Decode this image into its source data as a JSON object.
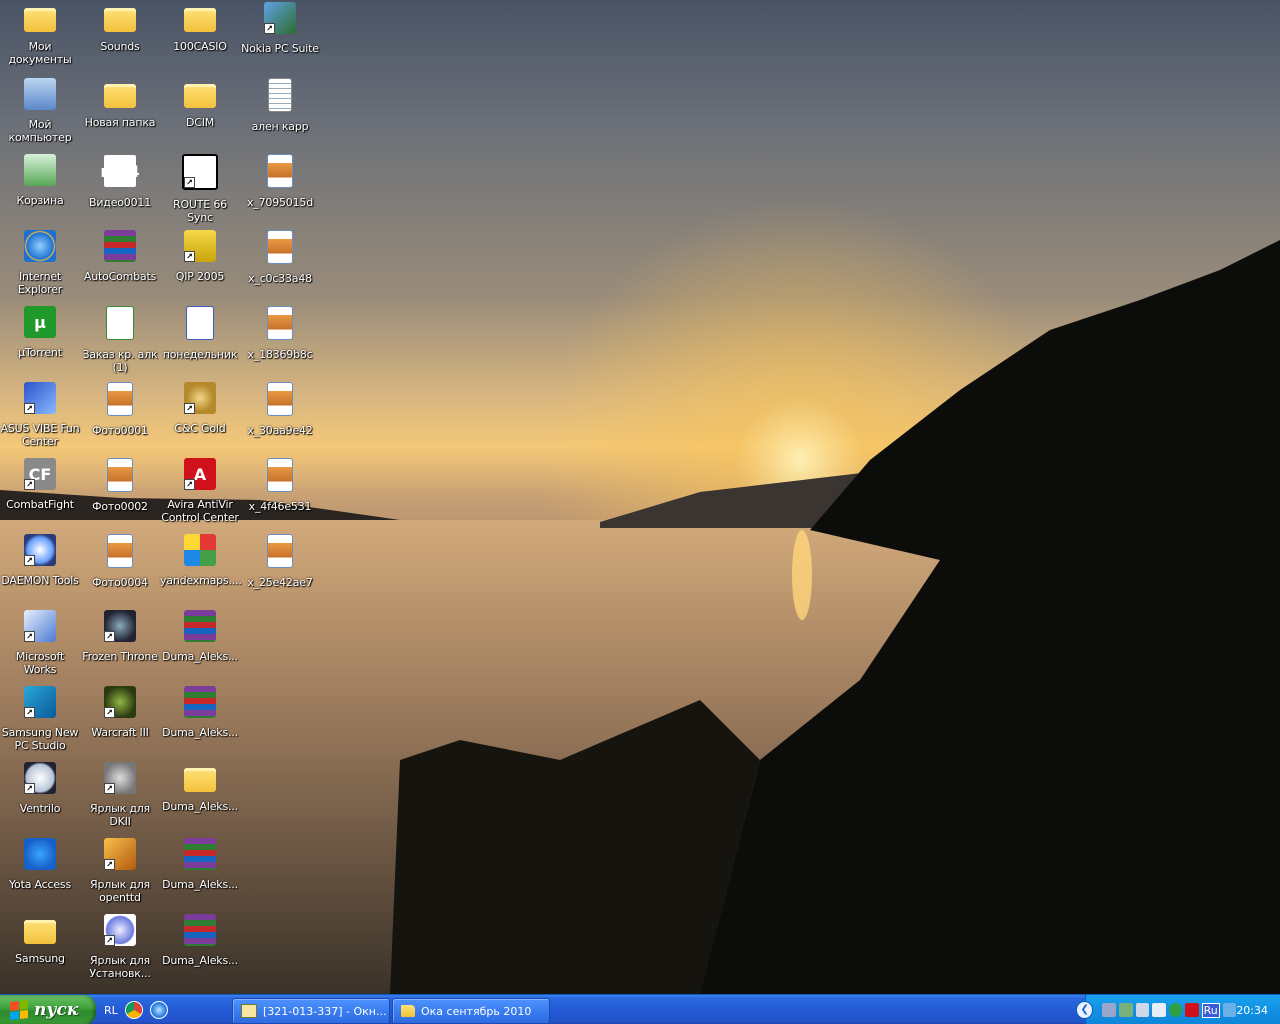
{
  "desktop": {
    "icons": [
      {
        "label": "Мои документы",
        "icon": "my-documents-icon",
        "col": 0,
        "row": 0,
        "art": "folder",
        "shortcut": false
      },
      {
        "label": "Мой компьютер",
        "icon": "my-computer-icon",
        "col": 0,
        "row": 1,
        "art": "computer",
        "shortcut": false
      },
      {
        "label": "Корзина",
        "icon": "recycle-bin-icon",
        "col": 0,
        "row": 2,
        "art": "recycle",
        "shortcut": false
      },
      {
        "label": "Internet Explorer",
        "icon": "internet-explorer-icon",
        "col": 0,
        "row": 3,
        "art": "ie",
        "shortcut": false
      },
      {
        "label": "µTorrent",
        "icon": "utorrent-icon",
        "col": 0,
        "row": 4,
        "art": "utor",
        "shortcut": false
      },
      {
        "label": "ASUS VIBE Fun Center",
        "icon": "asus-vibe-icon",
        "col": 0,
        "row": 5,
        "art": "asus",
        "shortcut": true
      },
      {
        "label": "CombatFight",
        "icon": "combatfight-icon",
        "col": 0,
        "row": 6,
        "art": "cf",
        "shortcut": true
      },
      {
        "label": "DAEMON Tools",
        "icon": "daemon-tools-icon",
        "col": 0,
        "row": 7,
        "art": "daemon",
        "shortcut": true
      },
      {
        "label": "Microsoft Works",
        "icon": "microsoft-works-icon",
        "col": 0,
        "row": 8,
        "art": "msworks",
        "shortcut": true
      },
      {
        "label": "Samsung New PC Studio",
        "icon": "samsung-pc-studio-icon",
        "col": 0,
        "row": 9,
        "art": "samsung-new",
        "shortcut": true
      },
      {
        "label": "Ventrilo",
        "icon": "ventrilo-icon",
        "col": 0,
        "row": 10,
        "art": "ventrilo",
        "shortcut": true
      },
      {
        "label": "Yota Access",
        "icon": "yota-access-icon",
        "col": 0,
        "row": 11,
        "art": "yota",
        "shortcut": false
      },
      {
        "label": "Samsung",
        "icon": "folder-icon",
        "col": 0,
        "row": 12,
        "art": "folder",
        "shortcut": false
      },
      {
        "label": "Sounds",
        "icon": "folder-icon",
        "col": 1,
        "row": 0,
        "art": "folder",
        "shortcut": false
      },
      {
        "label": "Новая папка",
        "icon": "folder-icon",
        "col": 1,
        "row": 1,
        "art": "folder",
        "shortcut": false
      },
      {
        "label": "Видео0011",
        "icon": "video-file-icon",
        "col": 1,
        "row": 2,
        "art": "video",
        "shortcut": false
      },
      {
        "label": "AutoCombats",
        "icon": "rar-archive-icon",
        "col": 1,
        "row": 3,
        "art": "rar",
        "shortcut": false
      },
      {
        "label": "Заказ кр. алк (1)",
        "icon": "excel-document-icon",
        "col": 1,
        "row": 4,
        "art": "xls",
        "shortcut": false
      },
      {
        "label": "Фото0001",
        "icon": "image-file-icon",
        "col": 1,
        "row": 5,
        "art": "img-photo",
        "shortcut": false
      },
      {
        "label": "Фото0002",
        "icon": "image-file-icon",
        "col": 1,
        "row": 6,
        "art": "img-photo",
        "shortcut": false
      },
      {
        "label": "Фото0004",
        "icon": "image-file-icon",
        "col": 1,
        "row": 7,
        "art": "img-photo",
        "shortcut": false
      },
      {
        "label": "Frozen Throne",
        "icon": "frozen-throne-icon",
        "col": 1,
        "row": 8,
        "art": "frozen",
        "shortcut": true
      },
      {
        "label": "Warcraft III",
        "icon": "warcraft-iii-icon",
        "col": 1,
        "row": 9,
        "art": "wc3",
        "shortcut": true
      },
      {
        "label": "Ярлык для DKII",
        "icon": "dkii-icon",
        "col": 1,
        "row": 10,
        "art": "dkii",
        "shortcut": true
      },
      {
        "label": "Ярлык для openttd",
        "icon": "openttd-icon",
        "col": 1,
        "row": 11,
        "art": "ottd",
        "shortcut": true
      },
      {
        "label": "Ярлык для Установк...",
        "icon": "installer-icon",
        "col": 1,
        "row": 12,
        "art": "install",
        "shortcut": true
      },
      {
        "label": "100CASIO",
        "icon": "folder-icon",
        "col": 2,
        "row": 0,
        "art": "folder",
        "shortcut": false
      },
      {
        "label": "DCIM",
        "icon": "folder-icon",
        "col": 2,
        "row": 1,
        "art": "folder",
        "shortcut": false
      },
      {
        "label": "ROUTE 66 Sync",
        "icon": "route66-icon",
        "col": 2,
        "row": 2,
        "art": "route",
        "shortcut": true
      },
      {
        "label": "QIP 2005",
        "icon": "qip-icon",
        "col": 2,
        "row": 3,
        "art": "qip",
        "shortcut": true
      },
      {
        "label": "понедельник",
        "icon": "word-document-icon",
        "col": 2,
        "row": 4,
        "art": "word",
        "shortcut": false
      },
      {
        "label": "C&C Gold",
        "icon": "cnc-gold-icon",
        "col": 2,
        "row": 5,
        "art": "cnc",
        "shortcut": true
      },
      {
        "label": "Avira AntiVir Control Center",
        "icon": "avira-icon",
        "col": 2,
        "row": 6,
        "art": "avira",
        "shortcut": true
      },
      {
        "label": "yandexmaps....",
        "icon": "yandex-maps-icon",
        "col": 2,
        "row": 7,
        "art": "ymaps",
        "shortcut": false
      },
      {
        "label": "Duma_Aleks...",
        "icon": "rar-archive-icon",
        "col": 2,
        "row": 8,
        "art": "rar",
        "shortcut": false
      },
      {
        "label": "Duma_Aleks...",
        "icon": "rar-archive-icon",
        "col": 2,
        "row": 9,
        "art": "rar",
        "shortcut": false
      },
      {
        "label": "Duma_Aleks...",
        "icon": "folder-icon",
        "col": 2,
        "row": 10,
        "art": "folder",
        "shortcut": false
      },
      {
        "label": "Duma_Aleks...",
        "icon": "rar-archive-icon",
        "col": 2,
        "row": 11,
        "art": "rar",
        "shortcut": false
      },
      {
        "label": "Duma_Aleks...",
        "icon": "rar-archive-icon",
        "col": 2,
        "row": 12,
        "art": "rar",
        "shortcut": false
      },
      {
        "label": "Nokia PC Suite",
        "icon": "nokia-pc-suite-icon",
        "col": 3,
        "row": 0,
        "art": "nokia",
        "shortcut": true
      },
      {
        "label": "ален карр",
        "icon": "text-document-icon",
        "col": 3,
        "row": 1,
        "art": "note",
        "shortcut": false
      },
      {
        "label": "x_7095015d",
        "icon": "image-file-icon",
        "col": 3,
        "row": 2,
        "art": "img-photo",
        "shortcut": false
      },
      {
        "label": "x_c0c33a48",
        "icon": "image-file-icon",
        "col": 3,
        "row": 3,
        "art": "img-photo",
        "shortcut": false
      },
      {
        "label": "x_18369b8c",
        "icon": "image-file-icon",
        "col": 3,
        "row": 4,
        "art": "img-photo",
        "shortcut": false
      },
      {
        "label": "x_30aa9e42",
        "icon": "image-file-icon",
        "col": 3,
        "row": 5,
        "art": "img-photo",
        "shortcut": false
      },
      {
        "label": "x_4f46e531",
        "icon": "image-file-icon",
        "col": 3,
        "row": 6,
        "art": "img-photo",
        "shortcut": false
      },
      {
        "label": "x_25e42ae7",
        "icon": "image-file-icon",
        "col": 3,
        "row": 7,
        "art": "img-photo",
        "shortcut": false
      }
    ]
  },
  "taskbar": {
    "start_label": "пуск",
    "quick_launch": {
      "lang_label": "RL",
      "items": [
        "chrome-icon",
        "ie-quicklaunch-icon"
      ]
    },
    "tasks": [
      {
        "label": "[321-013-337] - Окн...",
        "icon": "window-app-icon"
      },
      {
        "label": "Ока сентябрь 2010",
        "icon": "folder-icon"
      }
    ],
    "tray": {
      "icons": [
        "shield-icon",
        "network-icon",
        "monitor-icon",
        "volume-icon",
        "eye-icon",
        "avira-umbrella-icon"
      ],
      "language": "Ru",
      "clock": "20:34"
    }
  },
  "colors": {
    "taskbar_blue": "#2459d6",
    "start_green": "#3da23a",
    "tray_blue": "#1290e3"
  }
}
